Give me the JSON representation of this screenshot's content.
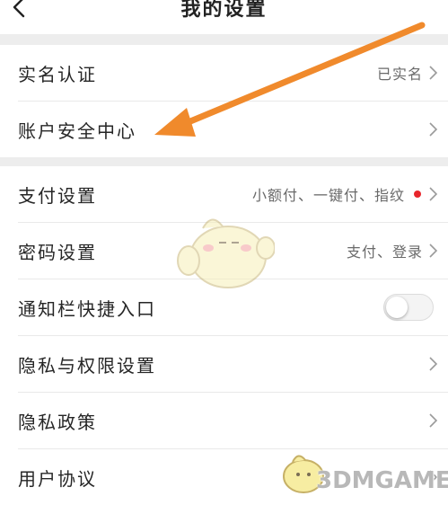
{
  "header": {
    "title": "我的设置",
    "back_icon": "chevron-left-icon"
  },
  "section1": {
    "items": [
      {
        "label": "实名认证",
        "value": "已实名"
      },
      {
        "label": "账户安全中心",
        "value": ""
      }
    ]
  },
  "section2": {
    "items": [
      {
        "label": "支付设置",
        "value": "小额付、一键付、指纹"
      },
      {
        "label": "密码设置",
        "value": "支付、登录"
      },
      {
        "label": "通知栏快捷入口",
        "toggle": "off"
      },
      {
        "label": "隐私与权限设置",
        "value": ""
      },
      {
        "label": "隐私政策",
        "value": ""
      },
      {
        "label": "用户协议",
        "value": ""
      }
    ]
  },
  "colors": {
    "accent_arrow": "#f08a2c",
    "red_dot": "#e8262c",
    "gap_gray": "#ededed"
  },
  "watermark": {
    "text": "3DMGAME"
  }
}
